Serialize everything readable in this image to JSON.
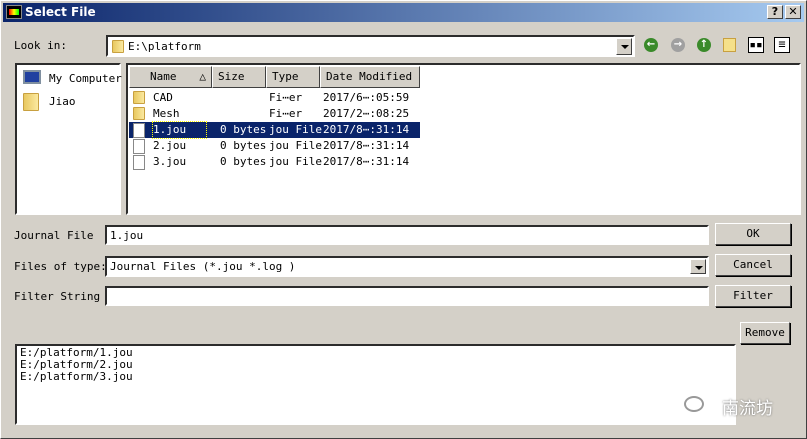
{
  "window": {
    "title": "Select File",
    "help_label": "?",
    "close_label": "✕"
  },
  "look_in": {
    "label": "Look in:",
    "value": "E:\\platform"
  },
  "toolbar": {
    "icons": [
      "back-icon",
      "forward-icon",
      "up-folder-icon",
      "new-folder-icon",
      "list-view-icon",
      "detail-view-icon"
    ]
  },
  "sidebar": {
    "items": [
      {
        "label": "My Computer",
        "icon": "computer-icon"
      },
      {
        "label": "Jiao",
        "icon": "user-folder-icon"
      }
    ]
  },
  "file_list": {
    "columns": [
      "Name",
      "Size",
      "Type",
      "Date Modified"
    ],
    "rows": [
      {
        "name": "CAD",
        "size": "",
        "type": "Fi⋯er",
        "date": "2017/6⋯:05:59",
        "icon": "folder",
        "selected": false
      },
      {
        "name": "Mesh",
        "size": "",
        "type": "Fi⋯er",
        "date": "2017/2⋯:08:25",
        "icon": "folder",
        "selected": false
      },
      {
        "name": "1.jou",
        "size": "0 bytes",
        "type": "jou File",
        "date": "2017/8⋯:31:14",
        "icon": "file",
        "selected": true
      },
      {
        "name": "2.jou",
        "size": "0 bytes",
        "type": "jou File",
        "date": "2017/8⋯:31:14",
        "icon": "file",
        "selected": false
      },
      {
        "name": "3.jou",
        "size": "0 bytes",
        "type": "jou File",
        "date": "2017/8⋯:31:14",
        "icon": "file",
        "selected": false
      }
    ]
  },
  "form": {
    "journal_label": "Journal File",
    "journal_value": "1.jou",
    "type_label": "Files of type:",
    "type_value": "Journal Files (*.jou *.log )",
    "filter_label": "Filter String",
    "filter_value": ""
  },
  "buttons": {
    "ok": "OK",
    "cancel": "Cancel",
    "filter": "Filter",
    "remove": "Remove"
  },
  "selected_files": [
    "E:/platform/1.jou",
    "E:/platform/2.jou",
    "E:/platform/3.jou"
  ],
  "watermark": "南流坊",
  "colors": {
    "title_start": "#0a246a",
    "title_end": "#a6caf0",
    "selection": "#0a246a",
    "face": "#d4d0c8"
  }
}
